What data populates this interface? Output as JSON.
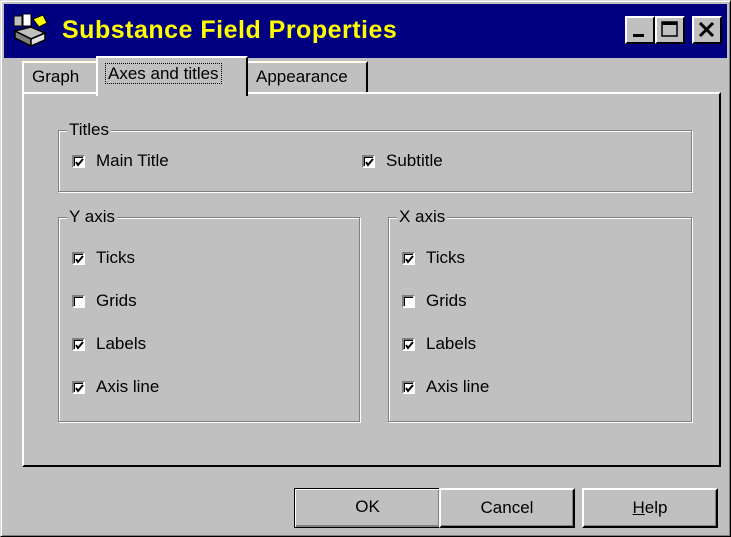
{
  "window": {
    "title": "Substance Field Properties",
    "title_icon": "app-icon"
  },
  "caption_buttons": {
    "minimize": "minimize-icon",
    "maximize": "maximize-icon",
    "close": "close-icon"
  },
  "tabs": [
    {
      "label": "Graph",
      "active": false
    },
    {
      "label": "Axes and titles",
      "active": true
    },
    {
      "label": "Appearance",
      "active": false
    }
  ],
  "titles_group": {
    "label": "Titles",
    "main_title": {
      "label": "Main Title",
      "checked": true
    },
    "subtitle": {
      "label": "Subtitle",
      "checked": true
    }
  },
  "y_axis": {
    "label": "Y axis",
    "ticks": {
      "label": "Ticks",
      "checked": true
    },
    "grids": {
      "label": "Grids",
      "checked": false
    },
    "labels": {
      "label": "Labels",
      "checked": true
    },
    "axis_line": {
      "label": "Axis line",
      "checked": true
    }
  },
  "x_axis": {
    "label": "X axis",
    "ticks": {
      "label": "Ticks",
      "checked": true
    },
    "grids": {
      "label": "Grids",
      "checked": false
    },
    "labels": {
      "label": "Labels",
      "checked": true
    },
    "axis_line": {
      "label": "Axis line",
      "checked": true
    }
  },
  "buttons": {
    "ok": "OK",
    "cancel": "Cancel",
    "help_first": "H",
    "help_rest": "elp"
  },
  "colors": {
    "titlebar": "#000080",
    "title_text": "#ffff00",
    "face": "#c0c0c0"
  }
}
